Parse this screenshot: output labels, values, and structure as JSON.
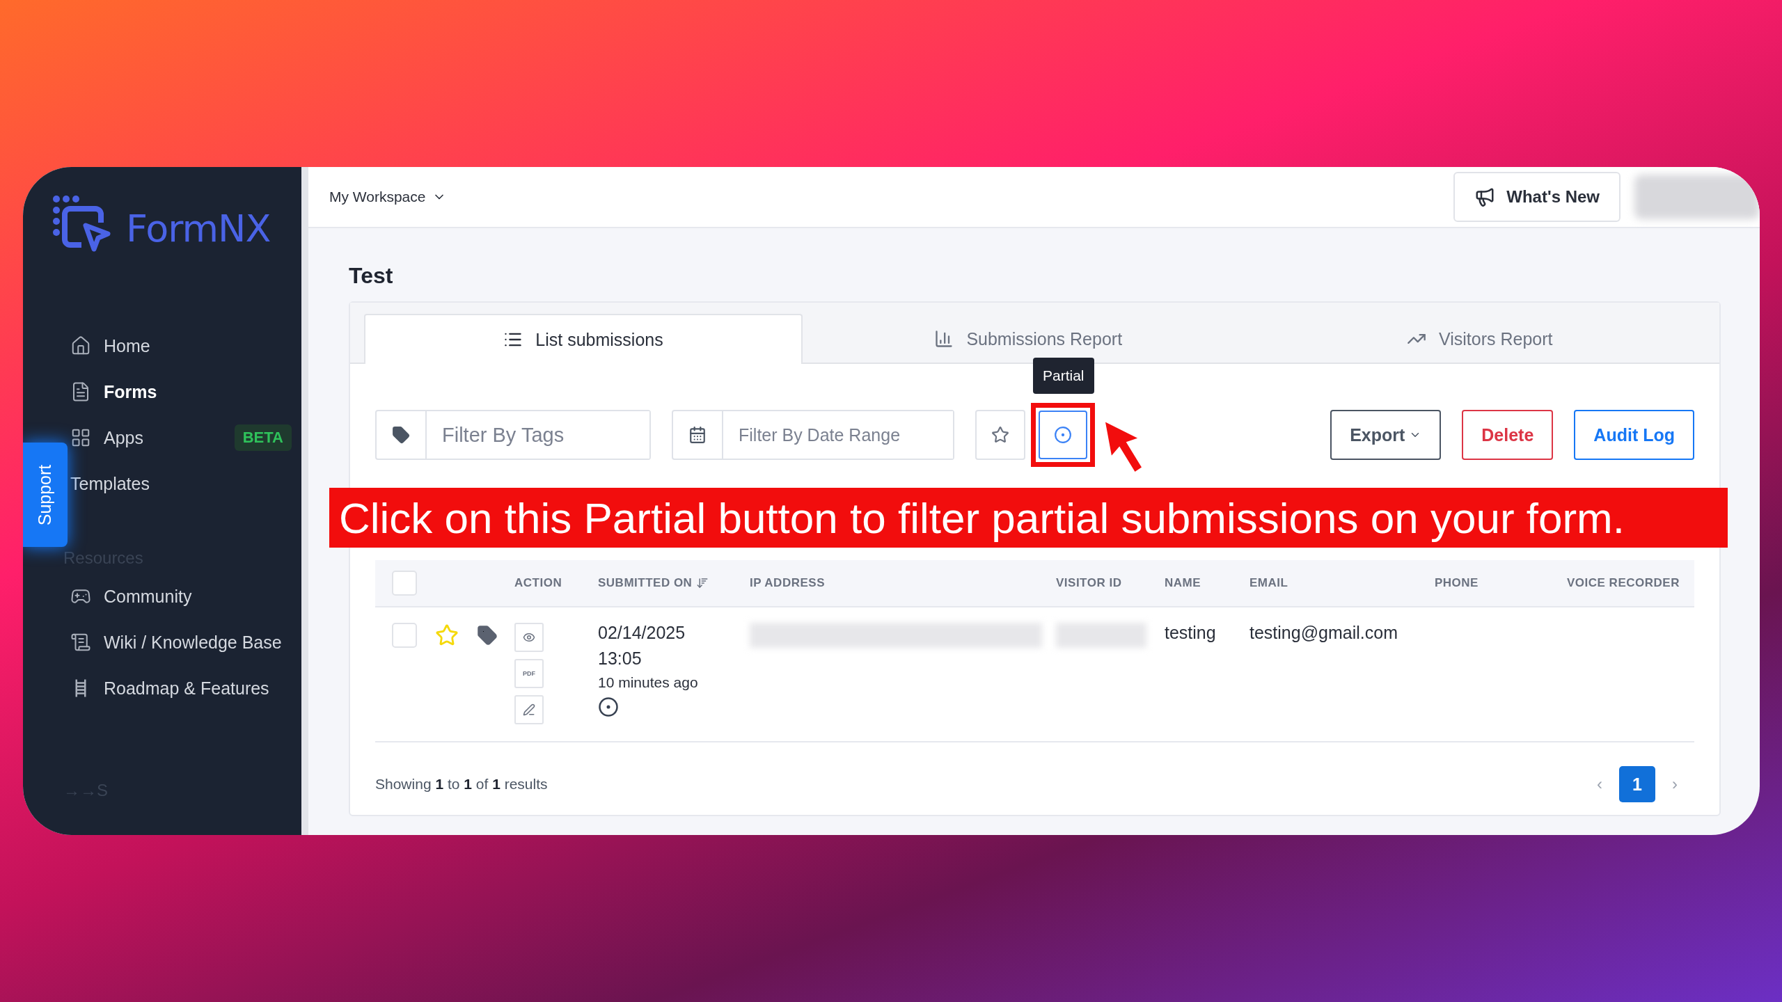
{
  "sidebar": {
    "logo": "FormNX",
    "items": [
      {
        "label": "Home",
        "selected": false
      },
      {
        "label": "Forms",
        "selected": true
      },
      {
        "label": "Apps",
        "selected": false,
        "badge": "BETA"
      },
      {
        "label": "Templates",
        "selected": false
      }
    ],
    "section_title": "Resources",
    "resource_items": [
      {
        "label": "Community"
      },
      {
        "label": "Wiki / Knowledge Base"
      },
      {
        "label": "Roadmap & Features"
      }
    ],
    "footer_text": "→→S",
    "support_tab": "Support"
  },
  "topbar": {
    "workspace": "My Workspace",
    "whats_new": "What's New"
  },
  "page_title": "Test",
  "tabs": [
    {
      "label": "List submissions",
      "selected": true
    },
    {
      "label": "Submissions Report",
      "selected": false
    },
    {
      "label": "Visitors Report",
      "selected": false
    }
  ],
  "toolbar": {
    "tags_placeholder": "Filter By Tags",
    "date_placeholder": "Filter By Date Range",
    "tooltip": "Partial",
    "export": "Export",
    "delete": "Delete",
    "audit_log": "Audit Log"
  },
  "annotation": "Click on this Partial button to filter partial submissions on your form.",
  "table": {
    "header_checked": false,
    "columns": [
      "ACTION",
      "SUBMITTED ON",
      "IP ADDRESS",
      "VISITOR ID",
      "NAME",
      "EMAIL",
      "PHONE",
      "VOICE RECORDER"
    ],
    "rows": [
      {
        "checked": false,
        "starred": false,
        "pdf": "PDF",
        "date": "02/14/2025",
        "time": "13:05",
        "ago": "10 minutes ago",
        "name": "testing",
        "email": "testing@gmail.com"
      }
    ]
  },
  "footer": {
    "summary": "Showing **1** to **1** of **1** results",
    "prev": "‹",
    "pages": [
      {
        "label": "1",
        "selected": true
      }
    ],
    "next": "›"
  }
}
